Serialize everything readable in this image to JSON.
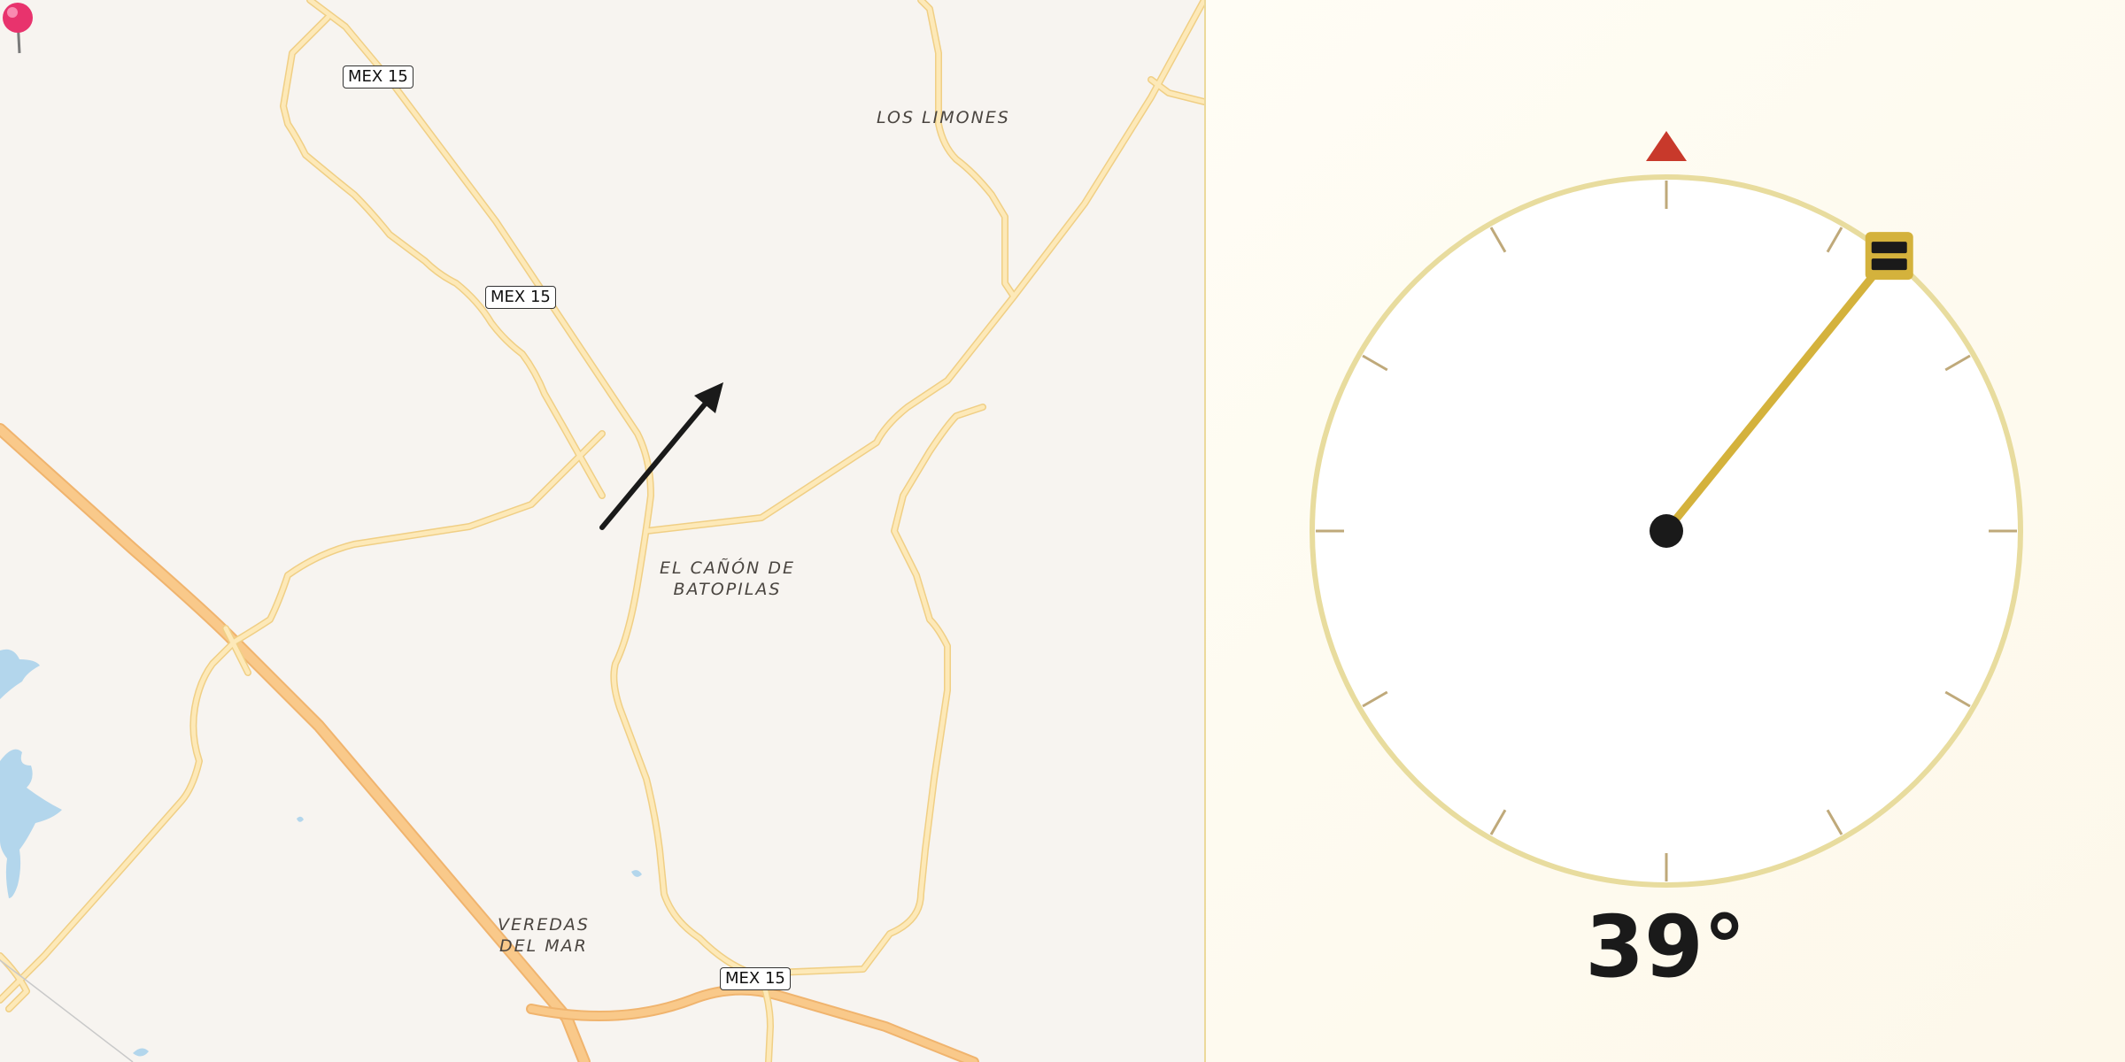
{
  "map": {
    "places": [
      {
        "id": "los-limones",
        "text": "LOS LIMONES"
      },
      {
        "id": "el-canon",
        "text": "EL CAÑÓN DE\nBATOPILAS"
      },
      {
        "id": "veredas",
        "text": "VEREDAS\nDEL MAR"
      }
    ],
    "route_shields": [
      "MEX 15",
      "MEX 15",
      "MEX 15"
    ],
    "pin_icon": "map-pin-icon",
    "direction_icon": "direction-arrow-icon"
  },
  "compass": {
    "bearing_deg": 39,
    "bearing_text": "39°",
    "north_marker_color": "#c8392b",
    "needle_color": "#d4b23c",
    "ring_color": "#e8dc9e",
    "tick_color": "#bfa97a"
  },
  "colors": {
    "map_bg": "#f7f4f0",
    "road_minor": "#fbe3a6",
    "road_major": "#f9c98a",
    "water": "#b3d6ec"
  }
}
